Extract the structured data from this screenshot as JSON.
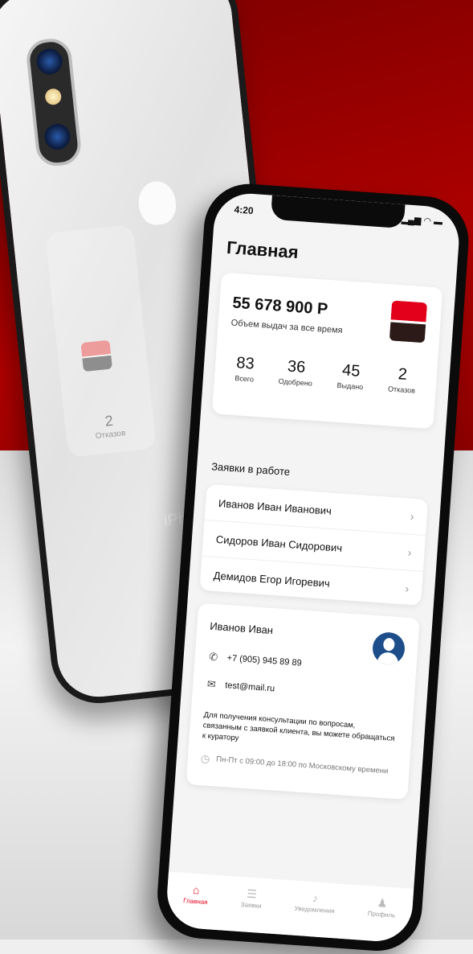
{
  "status": {
    "time": "4:20",
    "icons": "▐▐ • ▬"
  },
  "back_phone": {
    "brand": "iPhone",
    "ghost_num": "2",
    "ghost_label": "Отказов"
  },
  "page": {
    "title": "Главная"
  },
  "summary": {
    "amount": "55 678 900 Р",
    "amount_label": "Объем выдач за все время",
    "stats": [
      {
        "value": "83",
        "label": "Всего"
      },
      {
        "value": "36",
        "label": "Одобрено"
      },
      {
        "value": "45",
        "label": "Выдано"
      },
      {
        "value": "2",
        "label": "Отказов"
      }
    ]
  },
  "applications": {
    "title": "Заявки в работе",
    "items": [
      {
        "name": "Иванов Иван Иванович"
      },
      {
        "name": "Сидоров Иван Сидорович"
      },
      {
        "name": "Демидов Егор Игоревич"
      }
    ]
  },
  "curator": {
    "name": "Иванов Иван",
    "phone": "+7 (905) 945 89 89",
    "email": "test@mail.ru",
    "note": "Для получения консультации по вопросам, связанным с заявкой клиента, вы можете обращаться к куратору",
    "hours": "Пн-Пт с 09:00 до 18:00 по Московскому времени"
  },
  "tabs": [
    {
      "label": "Главная",
      "icon": "home-icon",
      "active": true
    },
    {
      "label": "Заявки",
      "icon": "list-icon",
      "active": false
    },
    {
      "label": "Уведомления",
      "icon": "bell-icon",
      "active": false
    },
    {
      "label": "Профиль",
      "icon": "user-icon",
      "active": false
    }
  ],
  "colors": {
    "accent": "#e3001b",
    "background_red": "#9a0000",
    "avatar": "#1d4e8a"
  }
}
